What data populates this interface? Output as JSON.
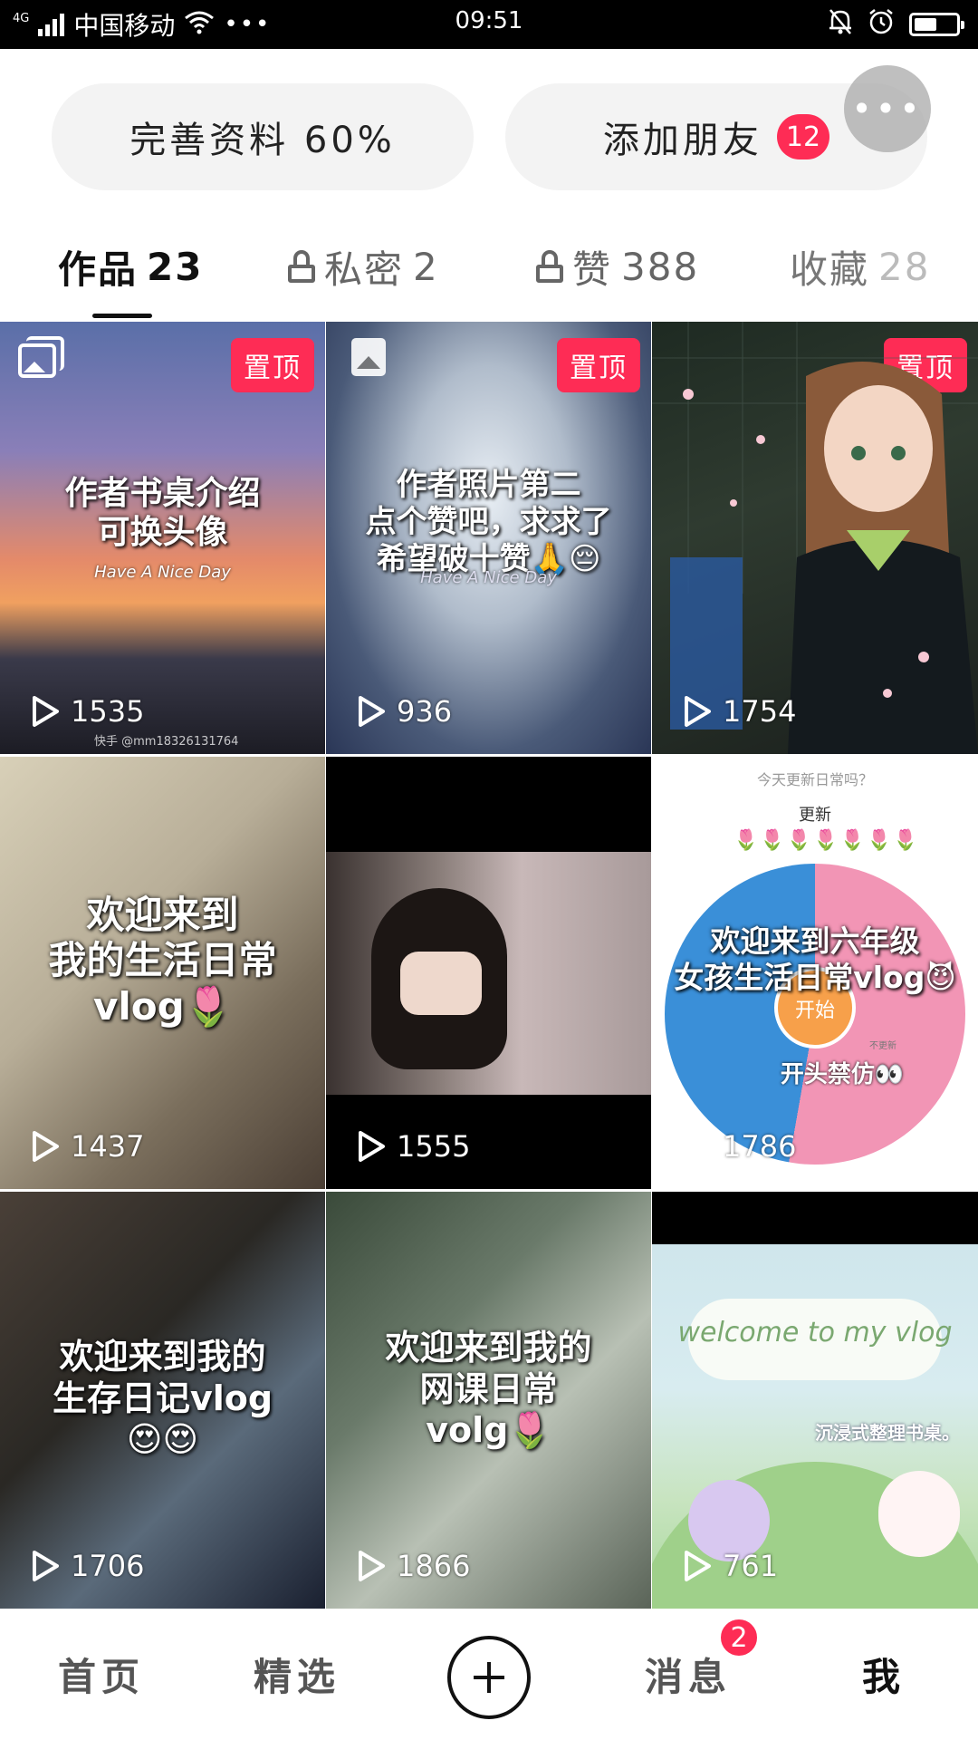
{
  "status_bar": {
    "network": "4G",
    "carrier": "中国移动",
    "time": "09:51",
    "battery_level": 0.55
  },
  "actions": {
    "profile_label": "完善资料 60%",
    "friends_label": "添加朋友",
    "friends_badge": "12",
    "more_label": "•••"
  },
  "tabs": [
    {
      "label": "作品",
      "count": "23",
      "active": true
    },
    {
      "label": "私密",
      "count": "2",
      "locked": true
    },
    {
      "label": "赞",
      "count": "388",
      "locked": true
    },
    {
      "label": "收藏",
      "count": "28"
    }
  ],
  "pinned_label": "置顶",
  "videos": [
    {
      "title": "作者书桌介绍\n可换头像",
      "subtitle": "Have A Nice Day",
      "plays": "1535",
      "pinned": true,
      "watermark": "快手 @mm18326131764"
    },
    {
      "title": "作者照片第二\n点个赞吧，求求了\n希望破十赞🙏😔",
      "subtitle": "Have A Nice Day",
      "plays": "936",
      "pinned": true
    },
    {
      "title": "",
      "plays": "1754",
      "pinned": true
    },
    {
      "title": "欢迎来到\n我的生活日常\nvlog🌷",
      "plays": "1437"
    },
    {
      "title": "",
      "plays": "1555"
    },
    {
      "title": "欢迎来到六年级\n女孩生活日常vlog😈",
      "top_text": "今天更新日常吗？",
      "top_text2": "更新",
      "button_text": "开始",
      "side_text": "开头禁仿👀",
      "small_text": "不更新",
      "plays": "1786"
    },
    {
      "title": "欢迎来到我的\n生存日记vlog\n😍😍",
      "plays": "1706"
    },
    {
      "title": "欢迎来到我的\n网课日常\nvolg🌷",
      "plays": "1866"
    },
    {
      "title": "welcome to my vlog",
      "side_text": "沉浸式整理书桌。",
      "plays": "761"
    }
  ],
  "bottom_nav": {
    "home": "首页",
    "featured": "精选",
    "messages": "消息",
    "messages_badge": "2",
    "me": "我"
  }
}
